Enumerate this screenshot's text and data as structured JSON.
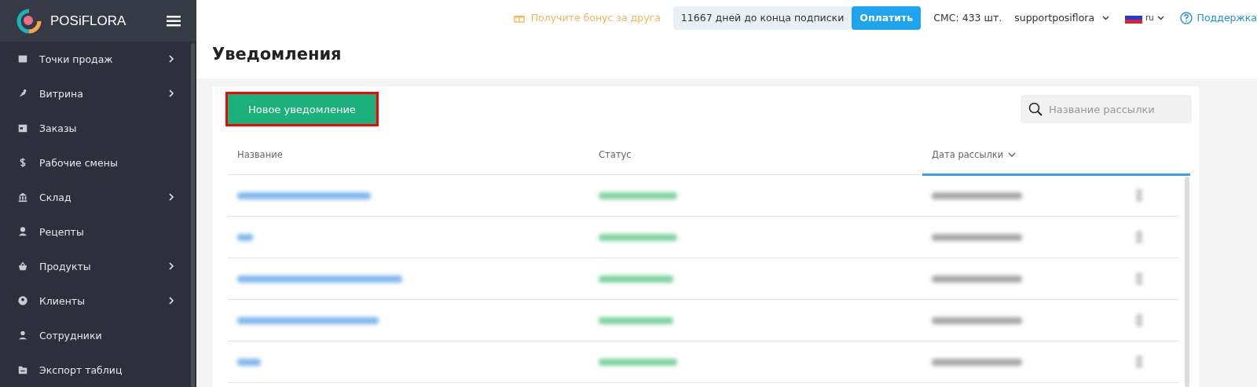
{
  "sidebar": {
    "brand": "POSiFLORA",
    "items": [
      {
        "label": "Точки продаж",
        "has_submenu": true
      },
      {
        "label": "Витрина",
        "has_submenu": true
      },
      {
        "label": "Заказы",
        "has_submenu": false
      },
      {
        "label": "Рабочие смены",
        "has_submenu": false
      },
      {
        "label": "Склад",
        "has_submenu": true
      },
      {
        "label": "Рецепты",
        "has_submenu": false
      },
      {
        "label": "Продукты",
        "has_submenu": true
      },
      {
        "label": "Клиенты",
        "has_submenu": true
      },
      {
        "label": "Сотрудники",
        "has_submenu": false
      },
      {
        "label": "Экспорт таблиц",
        "has_submenu": false
      }
    ]
  },
  "topbar": {
    "bonus": "Получите бонус за друга",
    "subscription": "11667 дней до конца подписки",
    "pay_button": "Оплатить",
    "sms": "СМС: 433 шт.",
    "account": "supportposiflora",
    "language": "ru",
    "support": "Поддержка"
  },
  "page": {
    "title": "Уведомления"
  },
  "toolbar": {
    "new_button": {
      "label": "Новое уведомление",
      "highlighted": true
    },
    "search": {
      "placeholder": "Название рассылки"
    }
  },
  "table": {
    "columns": [
      {
        "label": "Название",
        "sorted": false
      },
      {
        "label": "Статус",
        "sorted": false
      },
      {
        "label": "Дата рассылки",
        "sorted": true
      }
    ],
    "rows": [
      {
        "kind": "redacted"
      },
      {
        "kind": "redacted"
      },
      {
        "kind": "redacted"
      },
      {
        "kind": "redacted"
      },
      {
        "kind": "redacted"
      }
    ]
  }
}
